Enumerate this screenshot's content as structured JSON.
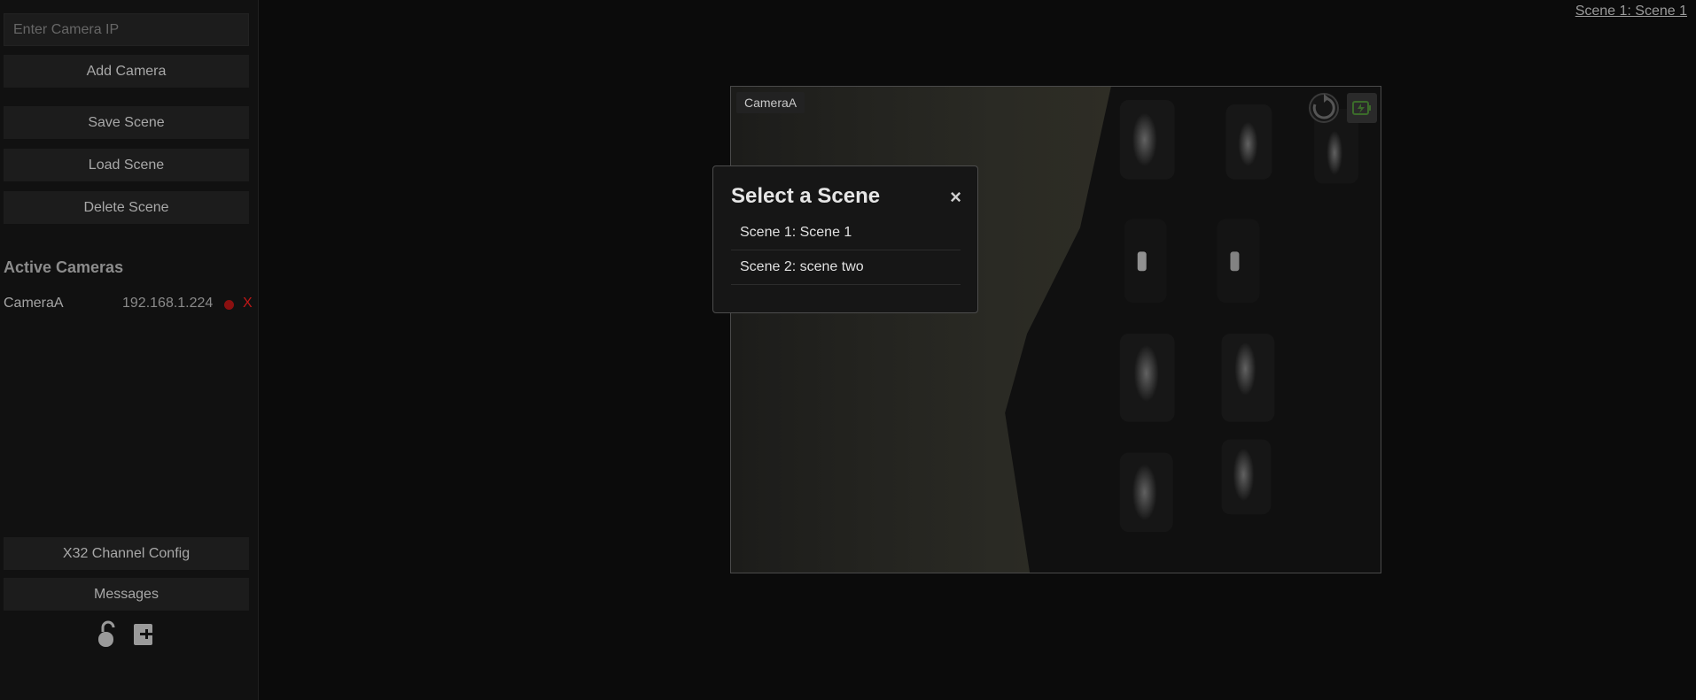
{
  "sidebar": {
    "ip_placeholder": "Enter Camera IP",
    "add_camera": "Add Camera",
    "save_scene": "Save Scene",
    "load_scene": "Load Scene",
    "delete_scene": "Delete Scene",
    "active_cameras_title": "Active Cameras",
    "cameras": [
      {
        "name": "CameraA",
        "ip": "192.168.1.224",
        "remove": "X",
        "status_color": "#8b1010"
      }
    ],
    "x32_config": "X32 Channel Config",
    "messages": "Messages",
    "icons": [
      "lock-icon",
      "logout-icon"
    ]
  },
  "header": {
    "current_scene": "Scene 1: Scene 1"
  },
  "camera_view": {
    "label": "CameraA",
    "icons": [
      "refresh-icon",
      "flash-icon"
    ]
  },
  "modal": {
    "title": "Select a Scene",
    "close": "×",
    "scenes": [
      "Scene 1: Scene 1",
      "Scene 2: scene two"
    ]
  },
  "colors": {
    "background": "#0b0b0b",
    "sidebar": "#111111",
    "button": "#1c1c1c",
    "danger": "#c01717"
  }
}
